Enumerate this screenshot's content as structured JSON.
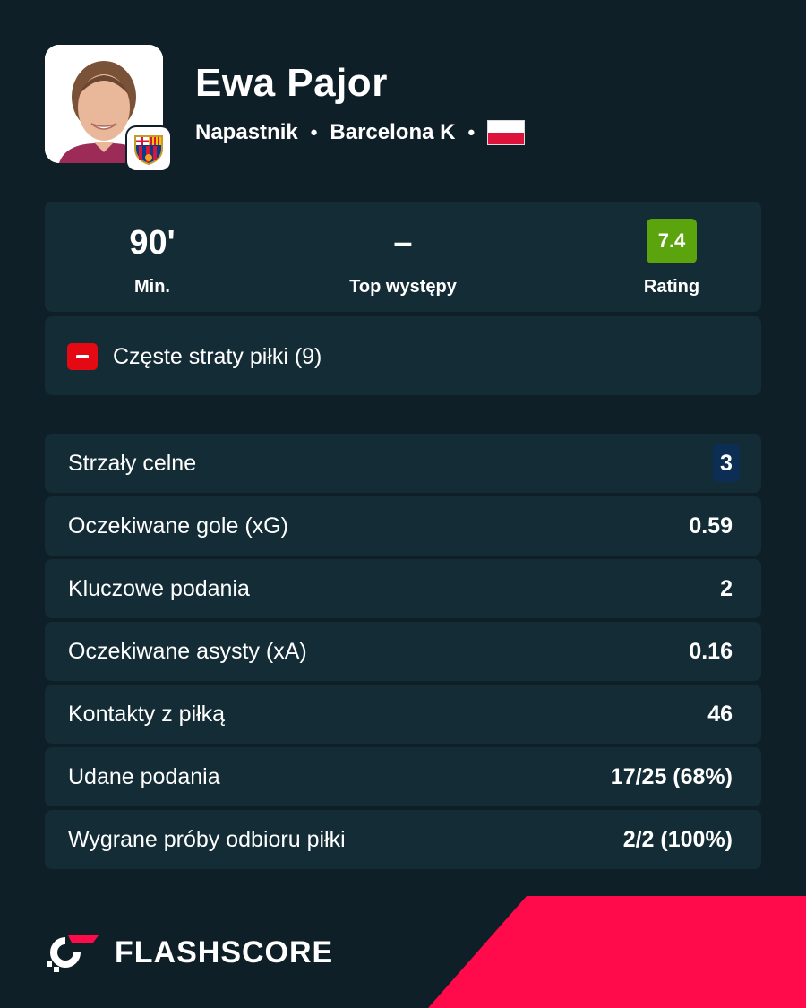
{
  "player": {
    "name": "Ewa Pajor",
    "position": "Napastnik",
    "club": "Barcelona K",
    "separator": "•",
    "flag_icon": "poland-flag-icon",
    "club_icon": "fc-barcelona-crest-icon"
  },
  "summary": {
    "minutes_value": "90'",
    "minutes_label": "Min.",
    "top_value": "–",
    "top_label": "Top występy",
    "rating_value": "7.4",
    "rating_label": "Rating",
    "rating_color": "#5ba40d"
  },
  "weakness": {
    "icon": "minus-icon",
    "text": "Częste straty piłki (9)",
    "color": "#e50914"
  },
  "stats": [
    {
      "label": "Strzały celne",
      "value": "3",
      "highlighted": true
    },
    {
      "label": "Oczekiwane gole (xG)",
      "value": "0.59"
    },
    {
      "label": "Kluczowe podania",
      "value": "2"
    },
    {
      "label": "Oczekiwane asysty (xA)",
      "value": "0.16"
    },
    {
      "label": "Kontakty z piłką",
      "value": "46"
    },
    {
      "label": "Udane podania",
      "value": "17/25 (68%)"
    },
    {
      "label": "Wygrane próby odbioru piłki",
      "value": "2/2 (100%)"
    }
  ],
  "brand": {
    "name": "FLASHSCORE",
    "logo_icon": "flashscore-logo-icon",
    "accent_color": "#ff0a4b"
  },
  "colors": {
    "background": "#0f1f28",
    "card": "#142c36"
  }
}
